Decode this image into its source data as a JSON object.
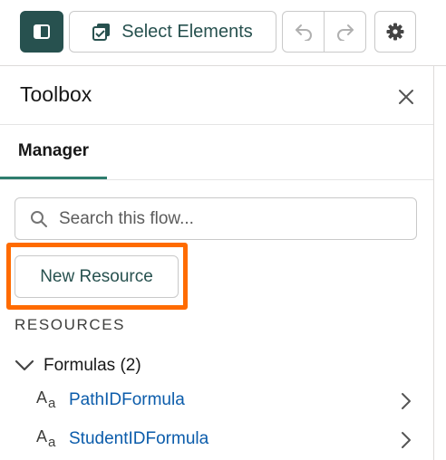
{
  "toolbar": {
    "select_label": "Select Elements"
  },
  "panel": {
    "title": "Toolbox",
    "tabs": [
      {
        "label": "Manager",
        "active": true
      }
    ]
  },
  "search": {
    "placeholder": "Search this flow..."
  },
  "new_resource": {
    "label": "New Resource"
  },
  "resources": {
    "section_label": "RESOURCES",
    "group": {
      "label": "Formulas (2)",
      "expanded": true,
      "items": [
        {
          "label": "PathIDFormula",
          "icon": "text-aa-icon"
        },
        {
          "label": "StudentIDFormula",
          "icon": "text-aa-icon"
        }
      ]
    }
  },
  "colors": {
    "brand": "#27514f",
    "tab_underline": "#2e7d6e",
    "highlight": "#ff6b00",
    "link": "#0b5cab"
  }
}
